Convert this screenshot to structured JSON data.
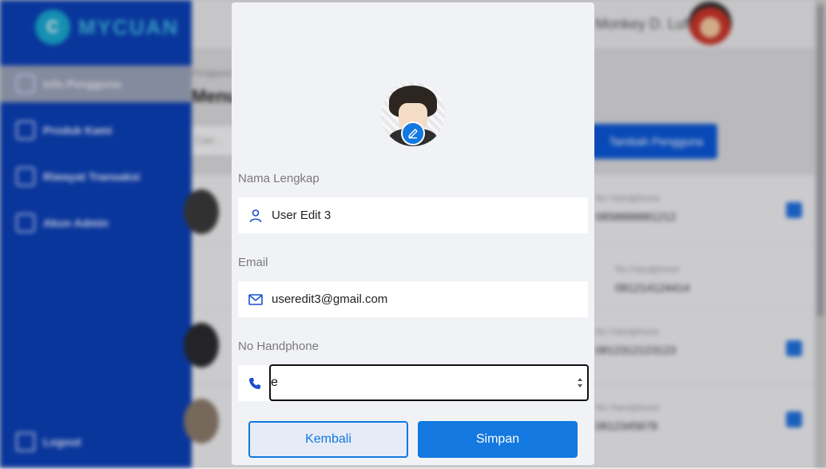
{
  "app": {
    "name": "MYCUAN",
    "logo_letter": "C"
  },
  "sidebar": {
    "items": [
      {
        "label": "Info Pengguna",
        "icon": "users-icon",
        "active": true
      },
      {
        "label": "Produk Kami",
        "icon": "calendar-icon",
        "active": false
      },
      {
        "label": "Riwayat Transaksi",
        "icon": "history-icon",
        "active": false
      },
      {
        "label": "Akun Admin",
        "icon": "admin-icon",
        "active": false
      }
    ],
    "logout_label": "Logout"
  },
  "header": {
    "admin_name": "Monkey D. Luffy"
  },
  "page": {
    "breadcrumb": "Pengguna",
    "title": "Menu Pengguna",
    "search_placeholder": "Cari...",
    "add_user_label": "Tambah Pengguna",
    "phone_column_label": "No Handphone",
    "users": [
      {
        "phone": "0858888881212"
      },
      {
        "phone": "081214124414"
      },
      {
        "phone": "0812312123123"
      },
      {
        "phone": "0812345678"
      }
    ]
  },
  "modal": {
    "name_label": "Nama Lengkap",
    "name_value": "User Edit 3",
    "email_label": "Email",
    "email_value": "useredit3@gmail.com",
    "phone_label": "No Handphone",
    "phone_value": "e",
    "back_label": "Kembali",
    "save_label": "Simpan"
  },
  "colors": {
    "primary": "#1378e0",
    "sidebar": "#0b3fb5",
    "modal_bg": "#f1f2f5"
  }
}
